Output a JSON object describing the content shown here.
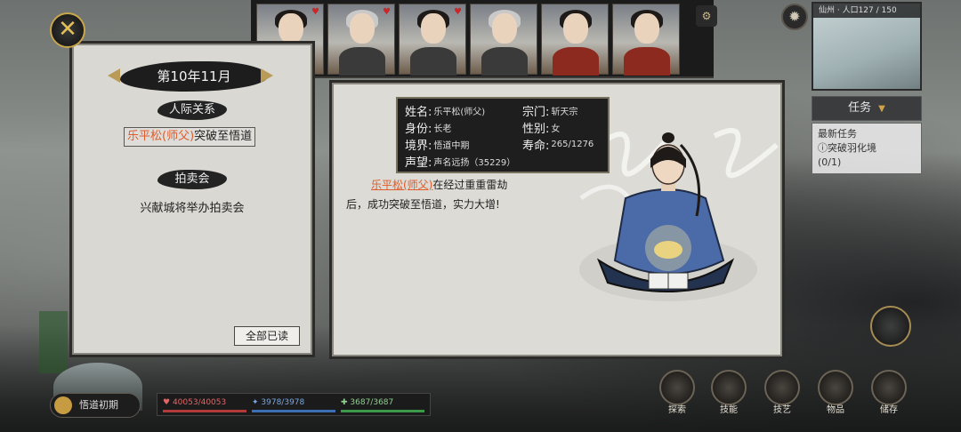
{
  "header": {
    "close_icon": "close-x-icon",
    "mini_map_label": "仙州 · 人口127 / 150",
    "gear_icon": "gear-icon",
    "scroll_icon": "scroll-icon"
  },
  "task_panel": {
    "title": "任务",
    "latest_label": "最新任务",
    "task_name": "突破羽化境",
    "progress": "(0/1)"
  },
  "news_window": {
    "month": "第10年11月",
    "sections": [
      {
        "title": "人际关系"
      },
      {
        "title": "拍卖会"
      }
    ],
    "relation_event": {
      "name": "乐平松(师父)",
      "text": "突破至悟道"
    },
    "auction_event": "兴献城将举办拍卖会",
    "read_all_label": "全部已读"
  },
  "detail_window": {
    "info": {
      "name_key": "姓名:",
      "name_val": "乐平松(师父)",
      "sect_key": "宗门:",
      "sect_val": "斩天宗",
      "identity_key": "身份:",
      "identity_val": "长老",
      "gender_key": "性别:",
      "gender_val": "女",
      "realm_key": "境界:",
      "realm_val": "悟道中期",
      "lifespan_key": "寿命:",
      "lifespan_val": "265/1276",
      "fame_key": "声望:",
      "fame_val": "声名远扬（35229）"
    },
    "story_name": "乐平松(师父)",
    "story_text_1": "在经过重重雷劫",
    "story_text_2": "后，成功突破至悟道，实力大增!"
  },
  "bottom_bar": {
    "rank_label": "悟道初期",
    "hp": "40053/40053",
    "mp": "3978/3978",
    "sp": "3687/3687",
    "actions": [
      "探索",
      "技能",
      "技艺",
      "物品",
      "储存"
    ]
  },
  "colors": {
    "accent_gold": "#c9a54a",
    "highlight_orange": "#e05b2a",
    "panel_bg": "#dcdbd6"
  }
}
